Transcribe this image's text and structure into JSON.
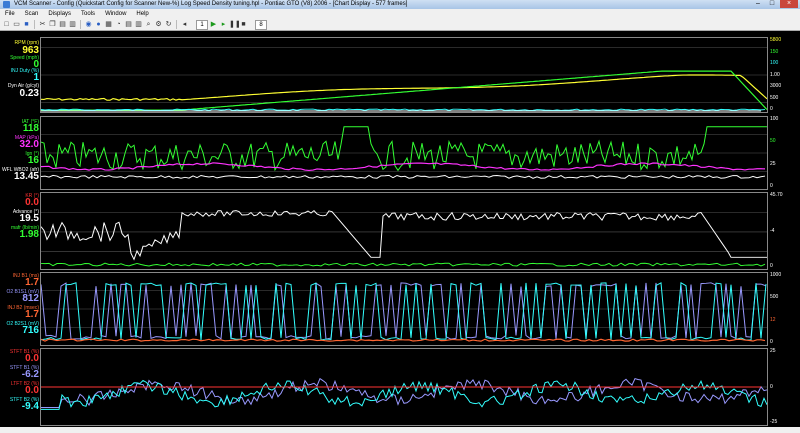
{
  "window": {
    "title": "VCM Scanner  -  Config  (Quickstart Config for Scanner New-%)  Log  Speed Density tuning.hpl  -  Pontiac GTO (V8) 2006  -  [Chart Display  -  577 frames]",
    "controls": [
      "–",
      "□",
      "×"
    ]
  },
  "menu": [
    "File",
    "Scan",
    "Displays",
    "Tools",
    "Window",
    "Help"
  ],
  "toolbar": {
    "icons": [
      "new-icon",
      "open-icon",
      "save-icon",
      "cut-icon",
      "copy-icon",
      "paste-icon",
      "print-icon",
      "scan-icon",
      "record-icon",
      "chart-icon",
      "gauge-icon",
      "table-icon",
      "histogram-icon",
      "zoom-icon",
      "settings-icon",
      "refresh-icon",
      "play-icon",
      "pause-icon",
      "stop-icon",
      "rewind-icon",
      "step-icon"
    ],
    "frame_box": "1",
    "step_value": "8"
  },
  "panes": [
    {
      "id": "p1",
      "params": [
        {
          "label": "RPM (rpm)",
          "value": "963",
          "color": "#ffff33"
        },
        {
          "label": "Speed (mph)",
          "value": "0",
          "color": "#33ff33"
        },
        {
          "label": "INJ Duty (%)",
          "value": "1",
          "color": "#33ffff"
        },
        {
          "label": "Dyn Air (g/cyl)",
          "value": "0.23",
          "color": "#ffffff"
        }
      ],
      "axis": [
        {
          "t": "5800",
          "c": "#ffff33"
        },
        {
          "t": "150",
          "c": "#33ff33"
        },
        {
          "t": "100",
          "c": "#33ffff"
        },
        {
          "t": "1.00",
          "c": "#ffffff"
        },
        {
          "t": "3000",
          "c": "#ffffff"
        },
        {
          "t": "500",
          "c": "#ffffff"
        },
        {
          "t": "0",
          "c": "#ffffff"
        }
      ]
    },
    {
      "id": "p2",
      "params": [
        {
          "label": "IAT (°F)",
          "value": "118",
          "color": "#33ff33"
        },
        {
          "label": "MAP (kPa)",
          "value": "32.0",
          "color": "#ff33ff"
        },
        {
          "label": "Ign (°)",
          "value": "16",
          "color": "#33ff33"
        },
        {
          "label": "WFL WBO2 (afr)",
          "value": "13.45",
          "color": "#ffffff"
        }
      ],
      "axis": [
        {
          "t": "100",
          "c": "#ffffff"
        },
        {
          "t": "50",
          "c": "#33ff33"
        },
        {
          "t": "25",
          "c": "#ffffff"
        },
        {
          "t": "0",
          "c": "#ffffff"
        }
      ]
    },
    {
      "id": "p3",
      "params": [
        {
          "label": "KR (°)",
          "value": "0.0",
          "color": "#ff3333"
        },
        {
          "label": "Advance (°)",
          "value": "19.5",
          "color": "#ffffff"
        },
        {
          "label": "mafr (lb/min)",
          "value": "1.98",
          "color": "#33ff33"
        }
      ],
      "axis": [
        {
          "t": "45.70",
          "c": "#ffffff"
        },
        {
          "t": "-4",
          "c": "#ffffff"
        },
        {
          "t": "0",
          "c": "#ffffff"
        }
      ]
    },
    {
      "id": "p4",
      "params": [
        {
          "label": "INJ B1 (ms)",
          "value": "1.7",
          "color": "#ff6633"
        },
        {
          "label": "O2 B1S1 (mV)",
          "value": "812",
          "color": "#9999ff"
        },
        {
          "label": "INJ B2 (msec)",
          "value": "1.7",
          "color": "#ff6633"
        },
        {
          "label": "O2 B2S1 (mV)",
          "value": "716",
          "color": "#33ffff"
        }
      ],
      "axis": [
        {
          "t": "1000",
          "c": "#ffffff"
        },
        {
          "t": "500",
          "c": "#ffffff"
        },
        {
          "t": "12",
          "c": "#ff6633"
        },
        {
          "t": "0",
          "c": "#ffffff"
        }
      ]
    },
    {
      "id": "p5",
      "params": [
        {
          "label": "STFT B1 (%)",
          "value": "0.0",
          "color": "#ff3333"
        },
        {
          "label": "STFT B1 (%)",
          "value": "-6.2",
          "color": "#9999ff"
        },
        {
          "label": "LTFT B2 (%)",
          "value": "0.0",
          "color": "#ff3333"
        },
        {
          "label": "STFT B2 (%)",
          "value": "-9.4",
          "color": "#33ffff"
        }
      ],
      "axis": [
        {
          "t": "25",
          "c": "#ffffff"
        },
        {
          "t": "0",
          "c": "#ffffff"
        },
        {
          "t": "-25",
          "c": "#ffffff"
        }
      ]
    }
  ],
  "colors": {
    "plot_bg": "#000000",
    "gridline": "#555555",
    "border": "#888888"
  }
}
